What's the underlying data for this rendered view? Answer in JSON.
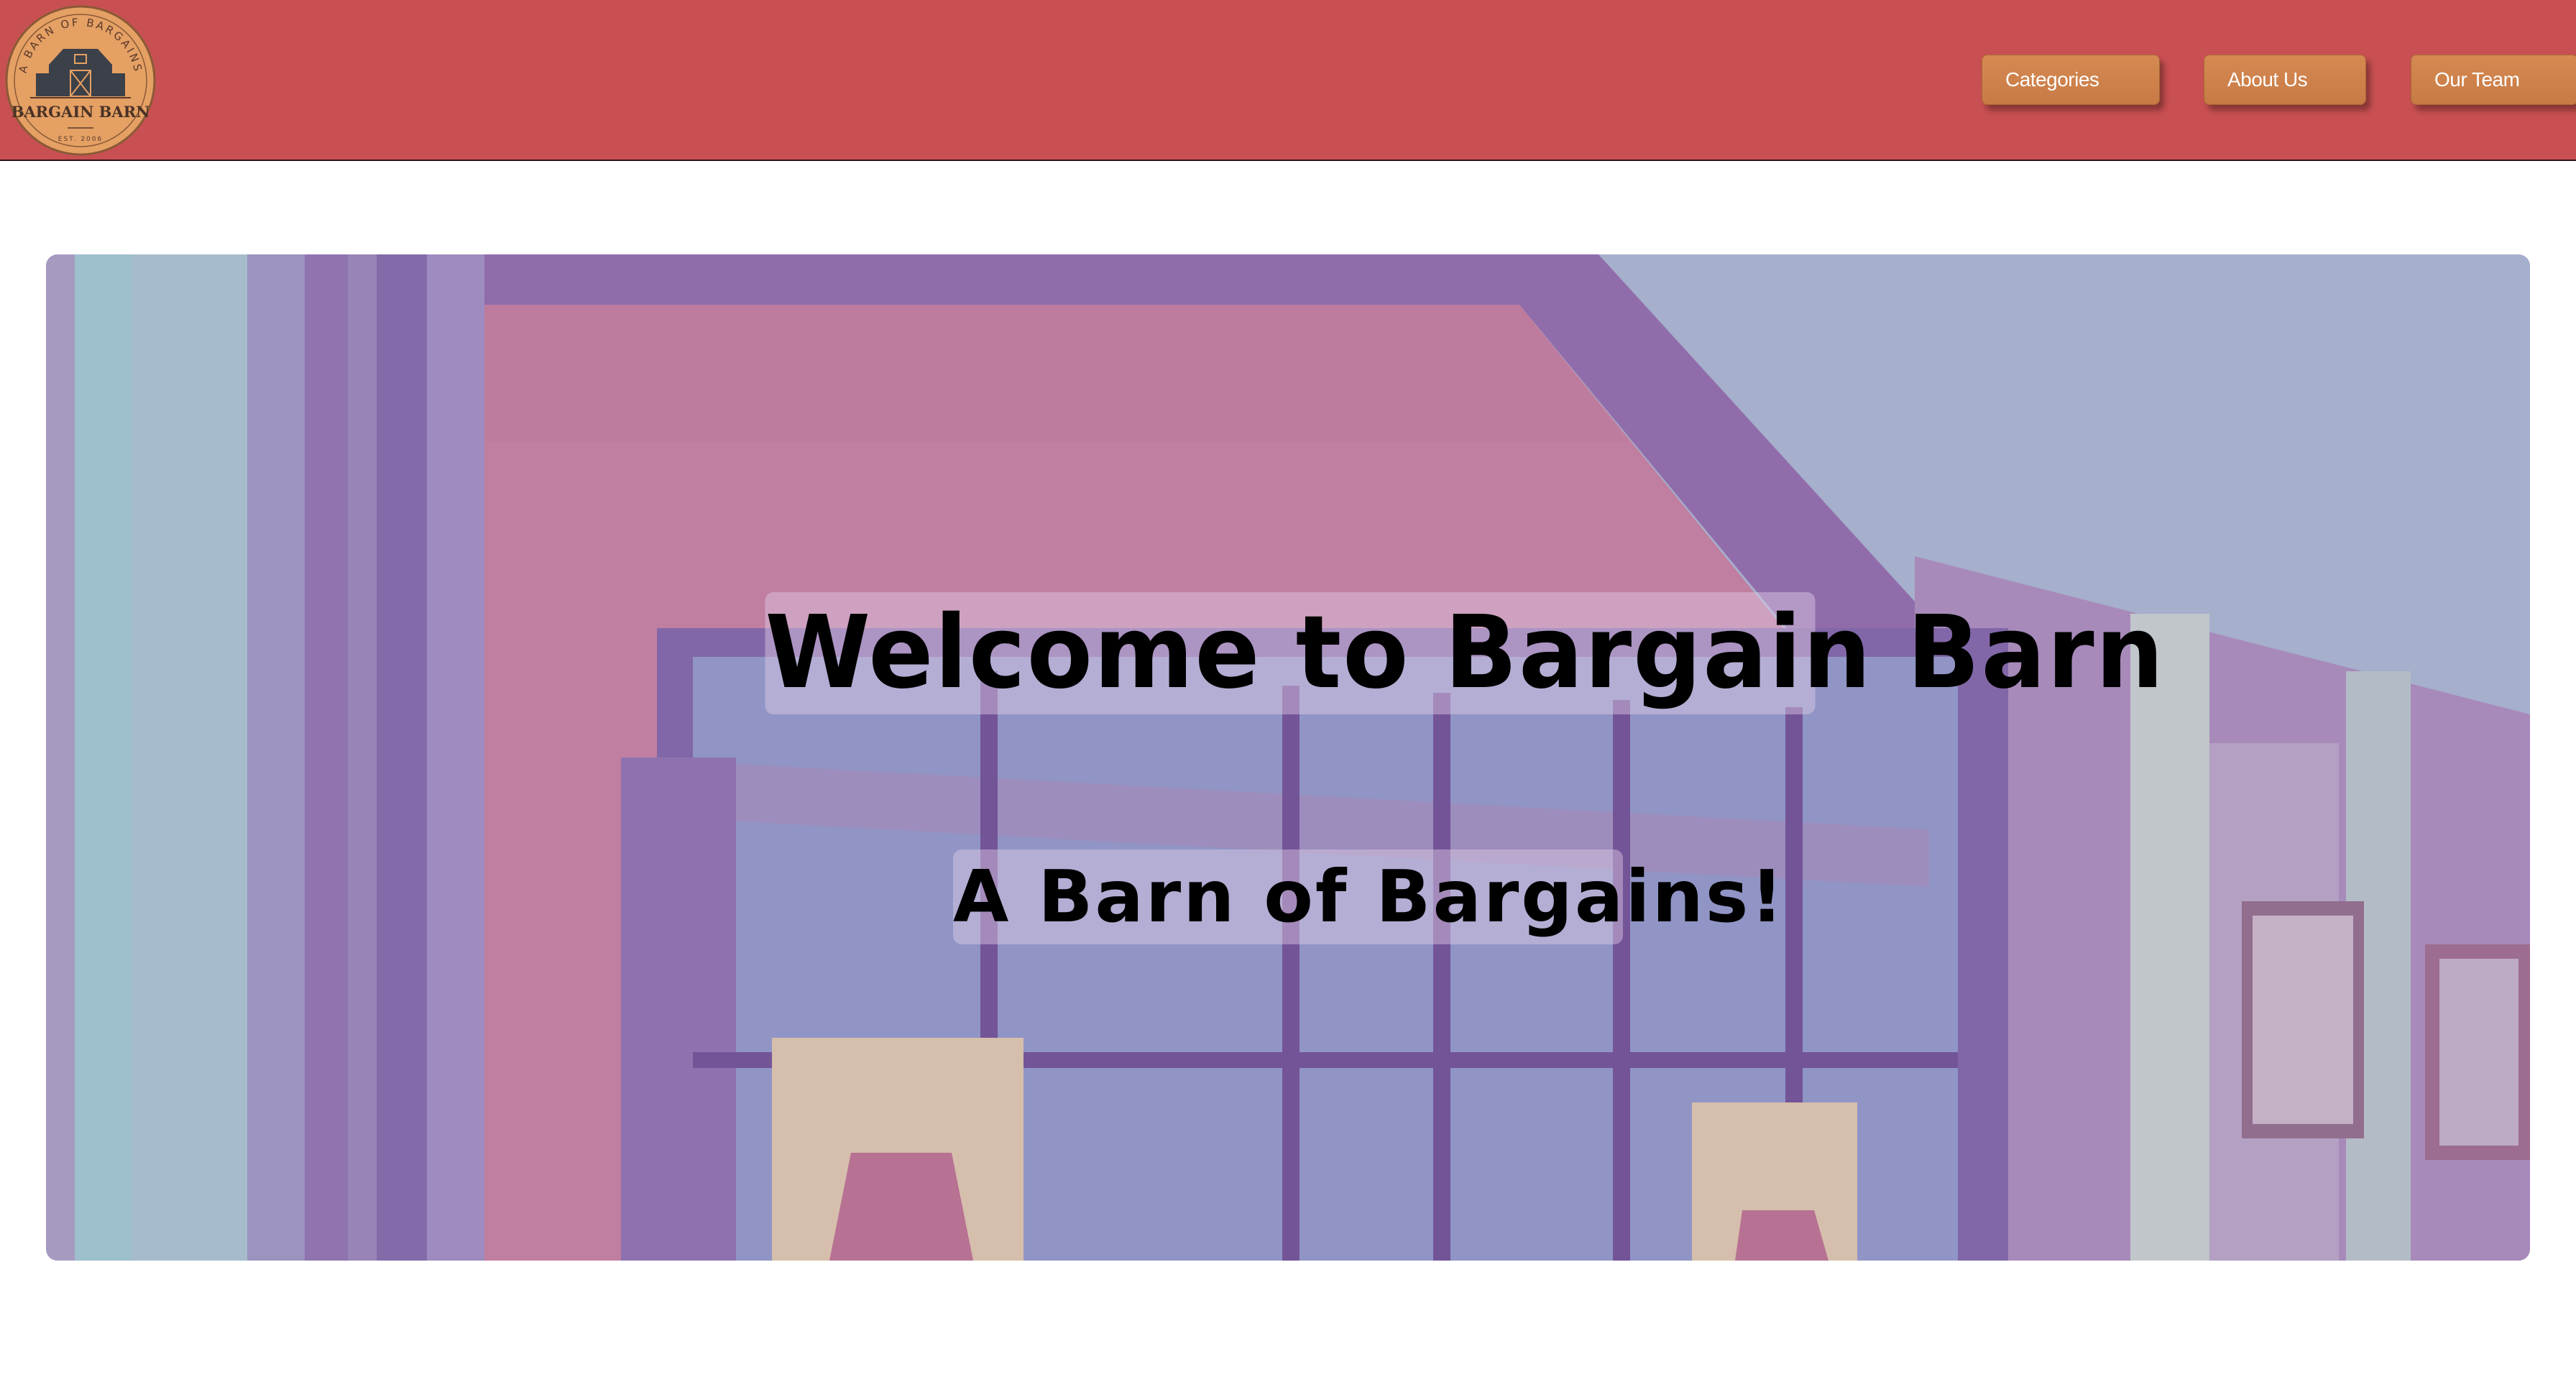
{
  "header": {
    "logo": {
      "arc_text": "A BARN OF BARGAINS",
      "name": "BARGAIN BARN",
      "est": "EST. 2006"
    },
    "nav": [
      {
        "label": "Categories"
      },
      {
        "label": "About Us"
      },
      {
        "label": "Our Team"
      }
    ],
    "colors": {
      "bar": "#c95052",
      "button": "#d68a52",
      "logo": "#e5a064"
    }
  },
  "hero": {
    "title": "Welcome to Bargain Barn",
    "subtitle": "A Barn of Bargains!",
    "background_image": "storefront-photo",
    "overlay_color": "#b080c0"
  }
}
